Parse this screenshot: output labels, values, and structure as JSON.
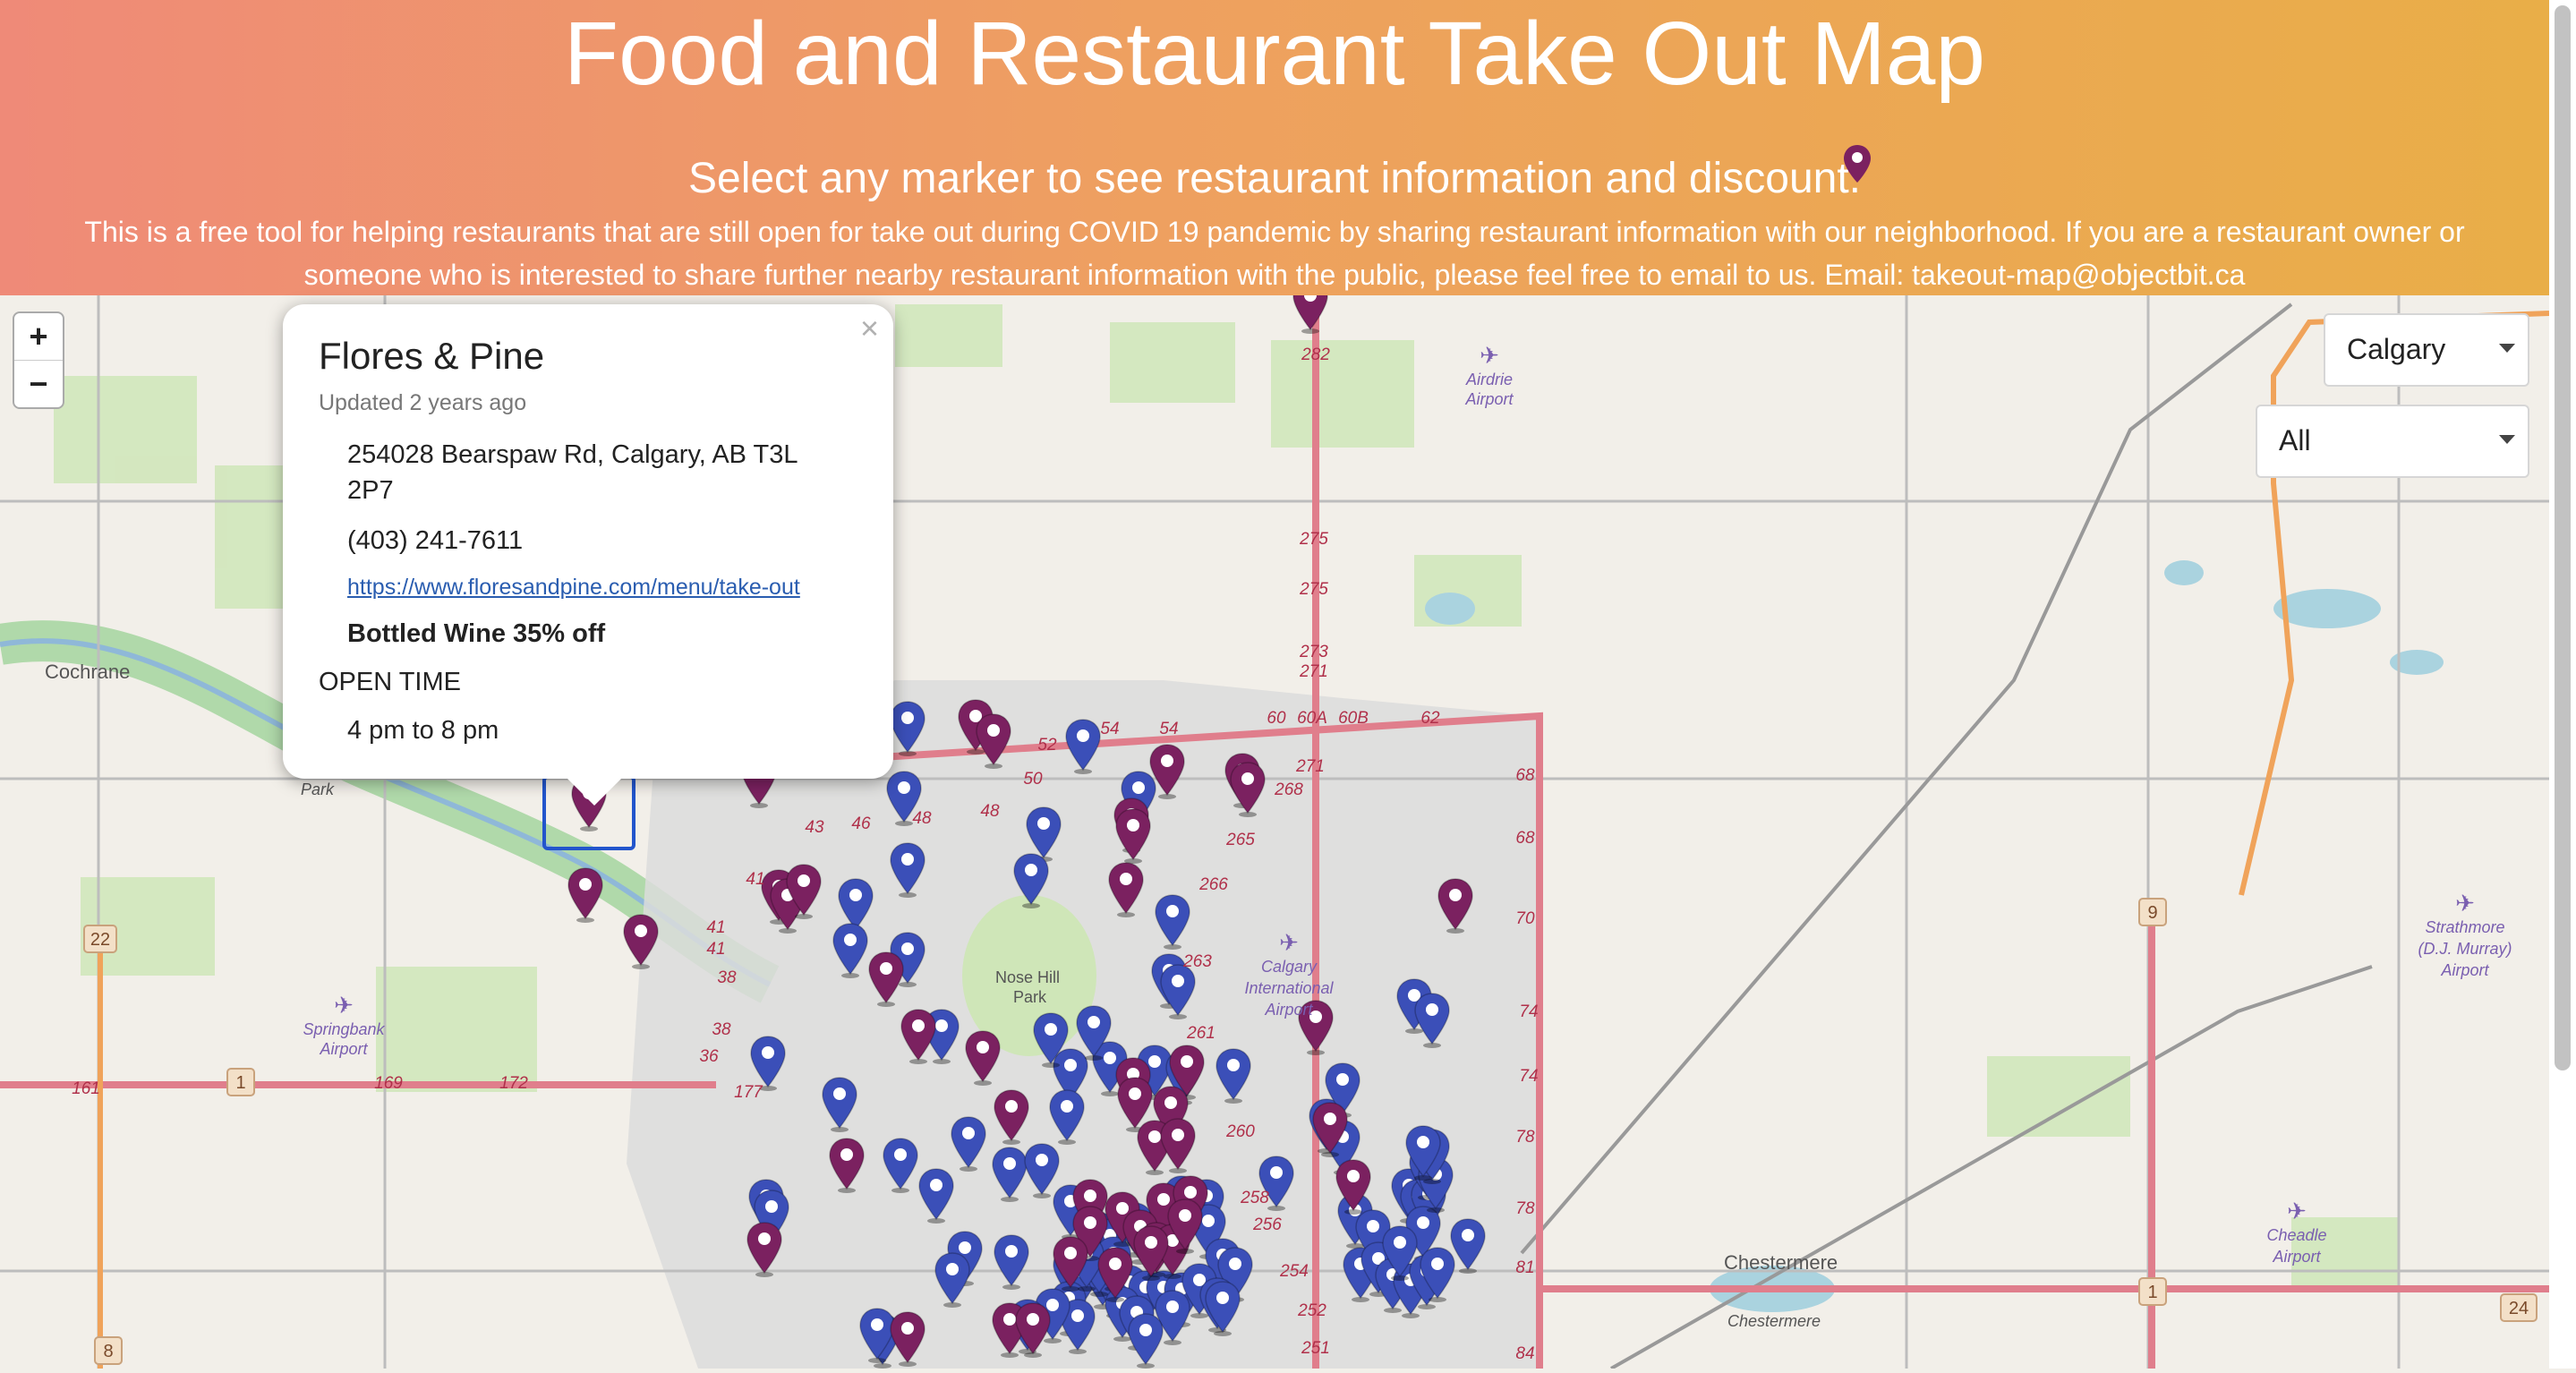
{
  "header": {
    "title": "Food and Restaurant Take Out Map",
    "instruction": "Select any marker to see restaurant information and discount.",
    "description": "This is a free tool for helping restaurants that are still open for take out during COVID 19 pandemic by sharing restaurant information with our neighborhood. If you are a restaurant owner or someone who is interested to share further nearby restaurant information with the public, please feel free to email to us. Email: takeout-map@objectbit.ca"
  },
  "zoom": {
    "in_label": "+",
    "out_label": "−"
  },
  "filters": {
    "city": {
      "selected": "Calgary"
    },
    "category": {
      "selected": "All"
    }
  },
  "popup": {
    "close": "×",
    "name": "Flores & Pine",
    "updated": "Updated 2 years ago",
    "address": "254028 Bearspaw Rd, Calgary, AB T3L 2P7",
    "phone": "(403) 241-7611",
    "website": "https://www.floresandpine.com/menu/take-out",
    "discount": "Bottled Wine 35% off",
    "open_label": "OPEN TIME",
    "open_time": "4 pm to 8 pm"
  },
  "map": {
    "places": {
      "cochrane": "Cochrane",
      "chestermere": "Chestermere",
      "chestermere_small": "Chestermere",
      "nose_hill_1": "Nose Hill",
      "nose_hill_2": "Park",
      "airdrie_1": "Airdrie",
      "airdrie_2": "Airport",
      "springbank_1": "Springbank",
      "springbank_2": "Airport",
      "calgary_intl_1": "Calgary",
      "calgary_intl_2": "International",
      "calgary_intl_3": "Airport",
      "strathmore_1": "Strathmore",
      "strathmore_2": "(D.J. Murray)",
      "strathmore_3": "Airport",
      "cheadle_1": "Cheadle",
      "cheadle_2": "Airport",
      "park": "Park"
    },
    "road_labels": {
      "r22": "22",
      "r1a": "1",
      "r1b": "1",
      "r9": "9",
      "r8": "8",
      "r24": "24",
      "r161": "161",
      "r169": "169",
      "r172": "172",
      "r177": "177",
      "r275a": "275",
      "r275b": "275",
      "r273": "273",
      "r271a": "271",
      "r271b": "271",
      "r268": "268",
      "r266": "266",
      "r263": "263",
      "r261": "261",
      "r260": "260",
      "r258": "258",
      "r256": "256",
      "r254": "254",
      "r252": "252",
      "r251": "251",
      "r60": "60",
      "r60a": "60A",
      "r60b": "60B",
      "r62": "62",
      "r68a": "68",
      "r68b": "68",
      "r70": "70",
      "r74a": "74",
      "r74b": "74",
      "r78a": "78",
      "r78b": "78",
      "r81": "81",
      "r84": "84",
      "r54a": "54",
      "r54b": "54",
      "r52": "52",
      "r50": "50",
      "r48a": "48",
      "r48b": "48",
      "r46": "46",
      "r43": "43",
      "r41a": "41",
      "r41b": "41",
      "r41c": "41",
      "r38a": "38",
      "r38b": "38",
      "r36": "36",
      "r282": "282",
      "r265": "265"
    },
    "marker_colors": {
      "blue": "#3b4fb8",
      "purple": "#7b2160"
    },
    "marker_counts": {
      "blue": 92,
      "purple": 46
    }
  }
}
